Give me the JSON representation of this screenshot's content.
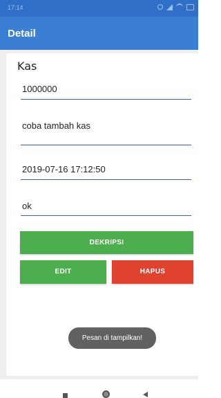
{
  "status_bar": {
    "time": "17:14",
    "icons": [
      "clock-icon",
      "signal-icon",
      "wifi-icon",
      "battery-icon"
    ]
  },
  "app_bar": {
    "title": "Detail"
  },
  "detail": {
    "title": "Kas",
    "fields": {
      "amount": "1000000",
      "description": "coba tambah kas",
      "datetime": "2019-07-16 17:12:50",
      "note": "ok"
    }
  },
  "buttons": {
    "decrypt": "DEKRIPSI",
    "edit": "EDIT",
    "delete": "HAPUS"
  },
  "toast": {
    "message": "Pesan di tampilkan!"
  },
  "navigation": {
    "icons": [
      "recent-apps-icon",
      "home-icon",
      "back-icon"
    ]
  },
  "colors": {
    "app_bar": "#3a7fd3",
    "status_bar": "#2f6fc7",
    "primary_button": "#4cae4c",
    "danger_button": "#e04230",
    "field_underline": "#3f5fb8"
  }
}
